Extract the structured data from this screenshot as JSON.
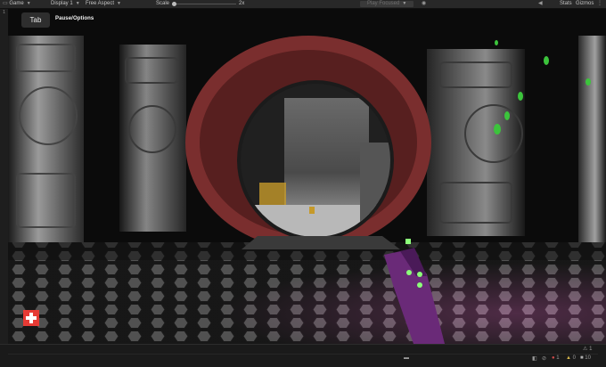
{
  "toolbar": {
    "view_select": "Game",
    "display_select": "Display 1",
    "aspect_select": "Free Aspect",
    "scale_label": "Scale",
    "scale_value": "2x",
    "play_mode": "Play Focused",
    "stats_label": "Stats",
    "gizmos_label": "Gizmos"
  },
  "hud": {
    "tab_key": "Tab",
    "pause_hint": "Pause/Options",
    "health_color": "#e63a34"
  },
  "status": {
    "error_count": "1",
    "warning_count": "0",
    "info_count": "10"
  },
  "colors": {
    "toolbar_bg": "#282828",
    "arch": "#7a2e2e",
    "weapon": "#6a2a78",
    "weapon_glow": "#8cff7a",
    "leaf": "#3cc43c"
  }
}
